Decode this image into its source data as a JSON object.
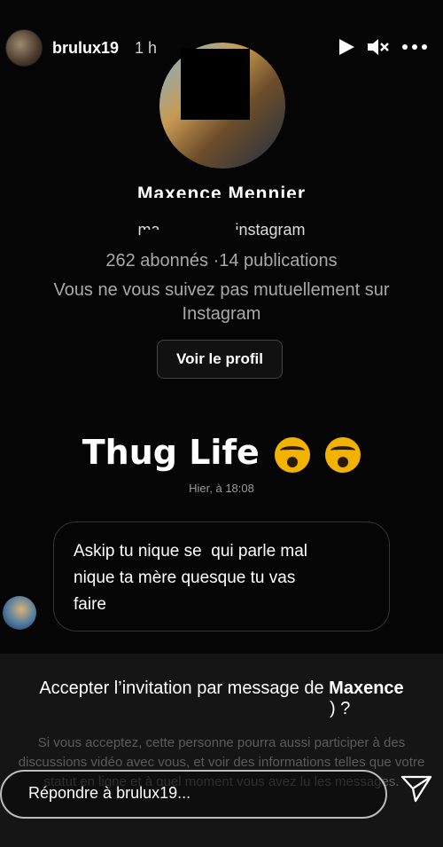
{
  "story": {
    "username": "brulux19",
    "time": "1 h"
  },
  "controls": {
    "play": "play-icon",
    "mute": "mute-icon",
    "more": "more-icon"
  },
  "profile": {
    "display_name": "Maxence Mennier",
    "handle": "ma.......  .........instagram",
    "stats": "262 abonnés ·14 publications",
    "mutual": "Vous ne vous suivez pas mutuellement sur Instagram",
    "view_profile_button": "Voir le profil"
  },
  "chat": {
    "thug_text": "Thug Life",
    "timestamp": "Hier, à 18:08",
    "message_lines": [
      "Askip tu nique se  qui parle mal",
      "nique ta mère quesque tu vas",
      "faire"
    ]
  },
  "request_panel": {
    "title_prefix": "Accepter l’invitation par message de ",
    "title_name": "Maxence",
    "title_suffix": ") ?",
    "info": "Si vous acceptez, cette personne pourra aussi participer à des discussions vidéo avec vous, et voir des informations telles que votre statut en ligne et à quel moment vous avez lu les messages."
  },
  "reply": {
    "placeholder": "Répondre à brulux19..."
  }
}
